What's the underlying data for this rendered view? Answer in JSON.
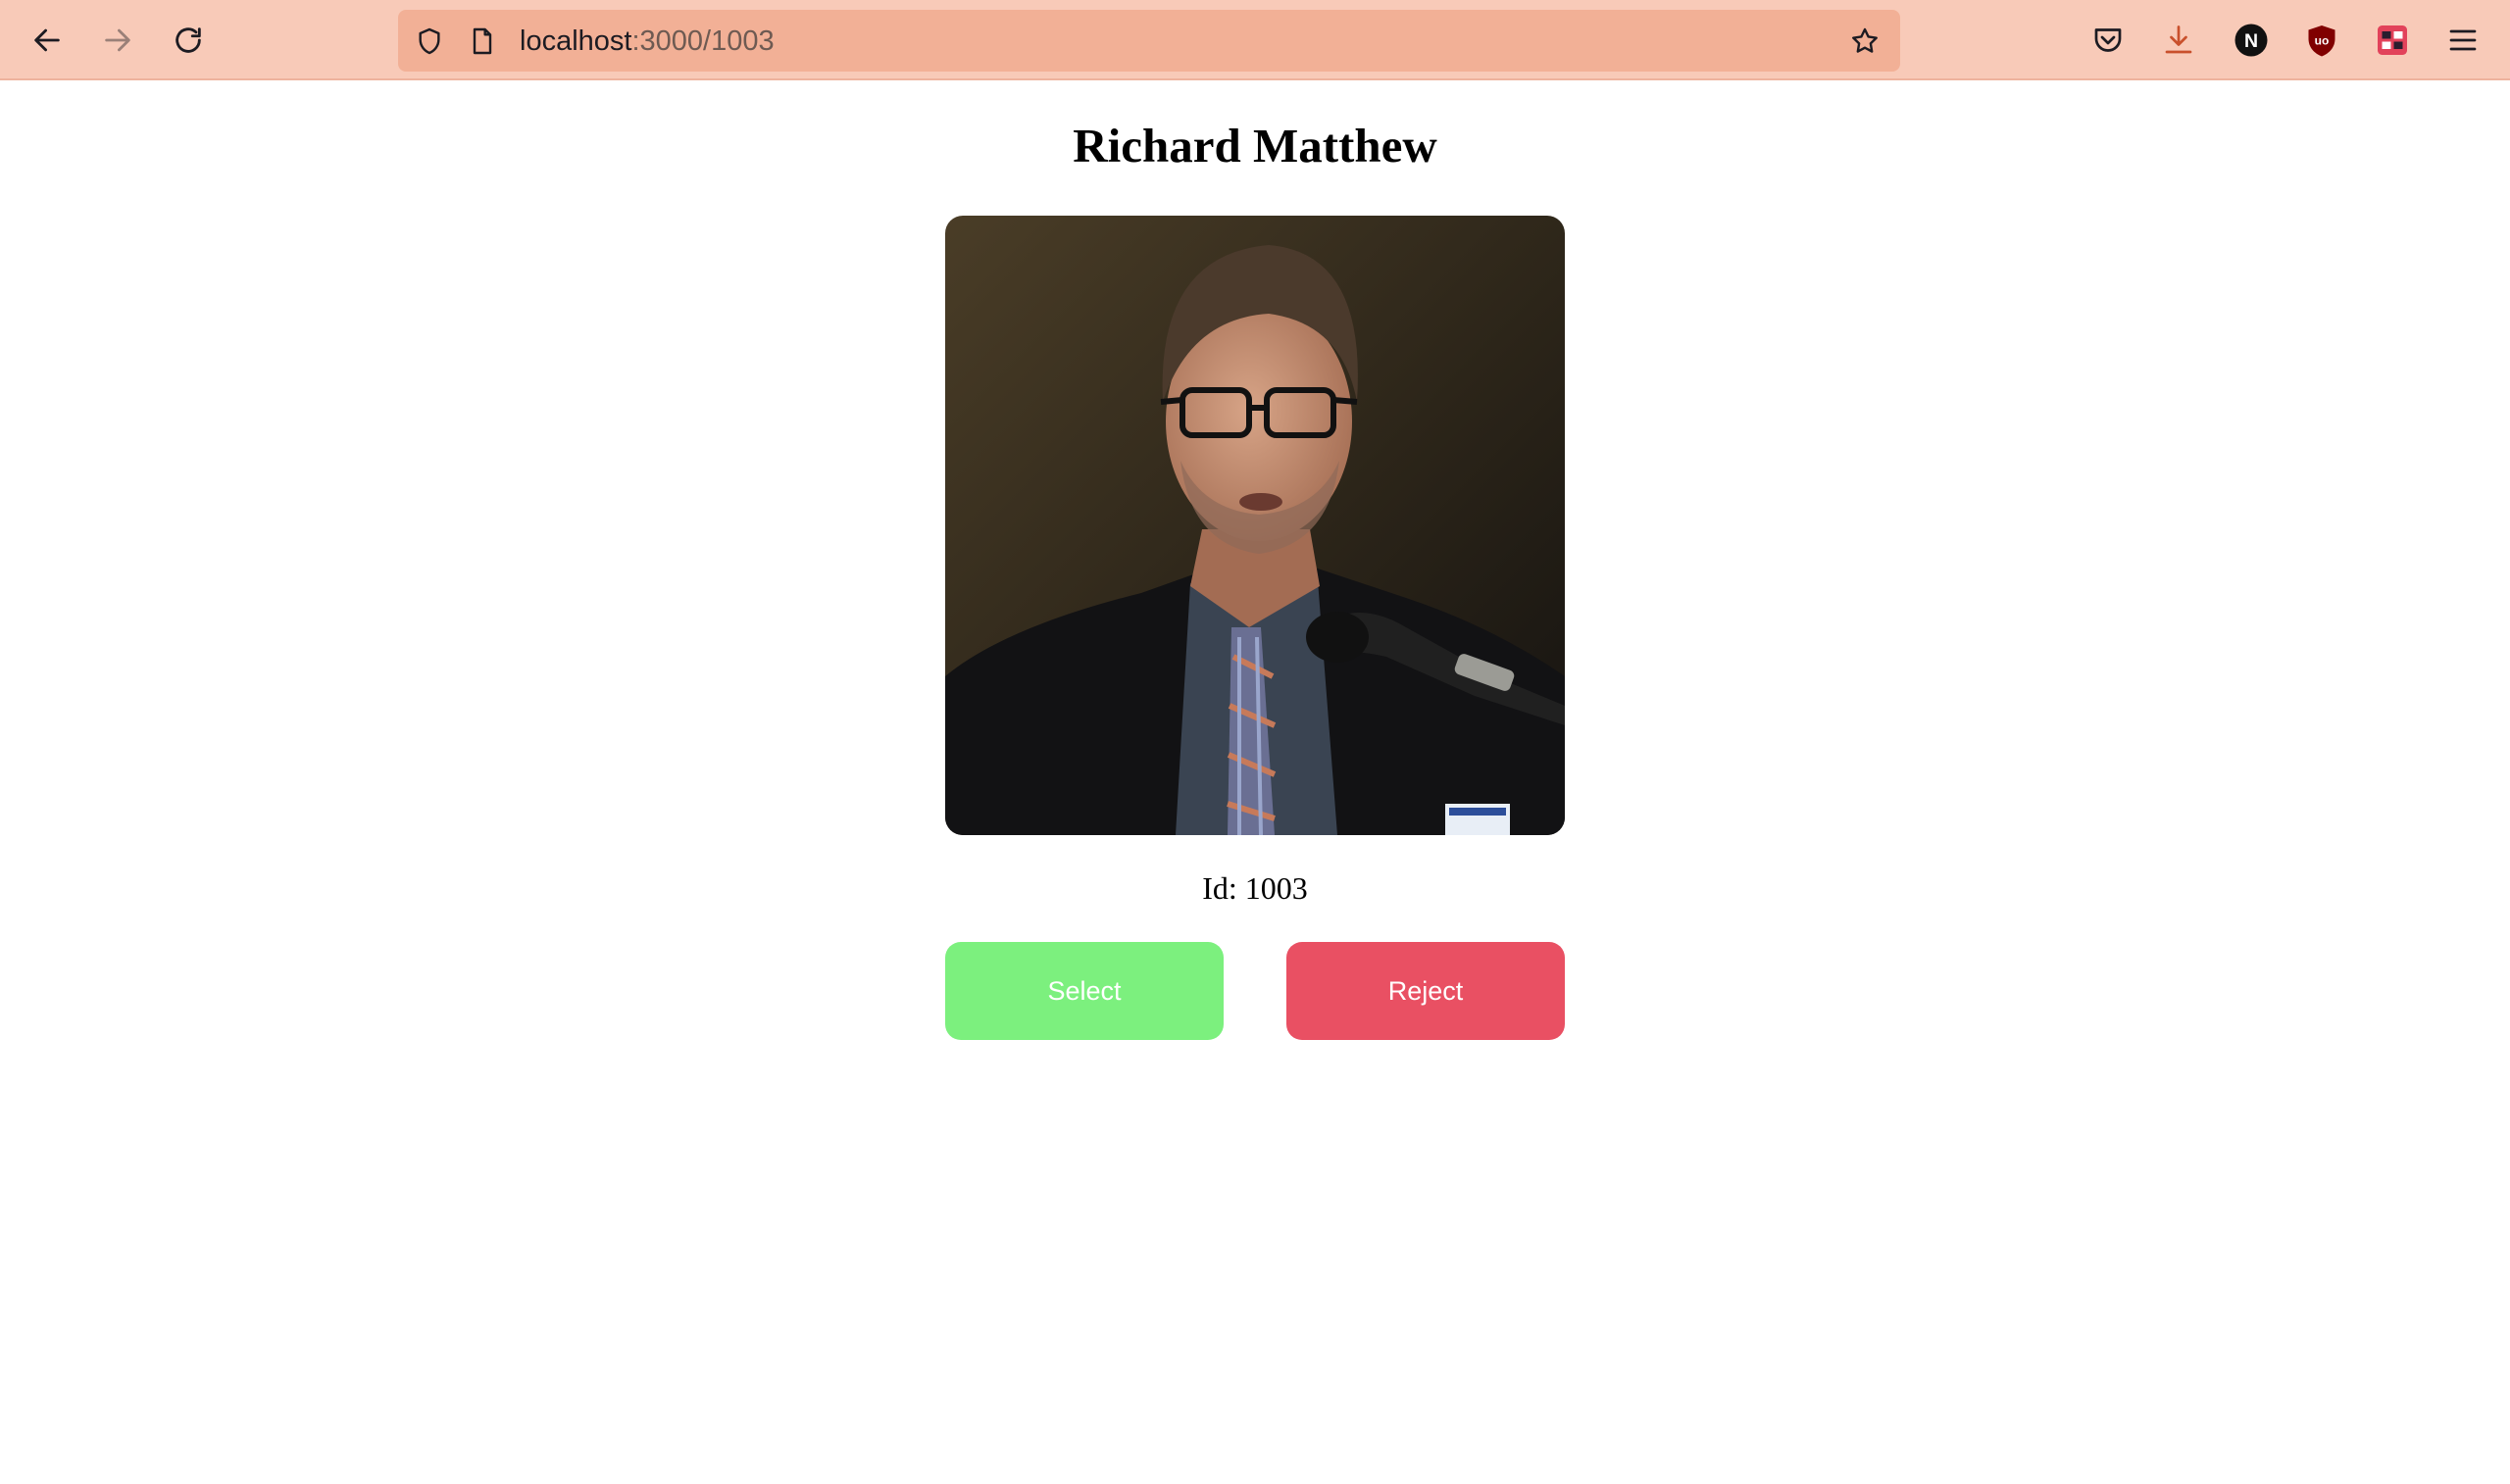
{
  "browser": {
    "url_host": "localhost",
    "url_path": ":3000/1003",
    "icons": {
      "back": "arrow-left-icon",
      "forward": "arrow-right-icon",
      "reload": "reload-icon",
      "tracking": "shield-icon",
      "page": "page-icon",
      "bookmark": "star-icon",
      "pocket": "pocket-icon",
      "downloads": "download-icon",
      "notion": "notion-icon",
      "ublock": "ublock-icon",
      "extension": "extension-icon",
      "menu": "hamburger-menu-icon"
    },
    "colors": {
      "toolbar": "#f8cab8",
      "urlbar": "#f2b096"
    }
  },
  "profile": {
    "name": "Richard Matthew",
    "id_text": "Id: 1003",
    "photo": "portrait-photo"
  },
  "actions": {
    "select_label": "Select",
    "reject_label": "Reject",
    "select_color": "#7cf07e",
    "reject_color": "#e95063"
  }
}
